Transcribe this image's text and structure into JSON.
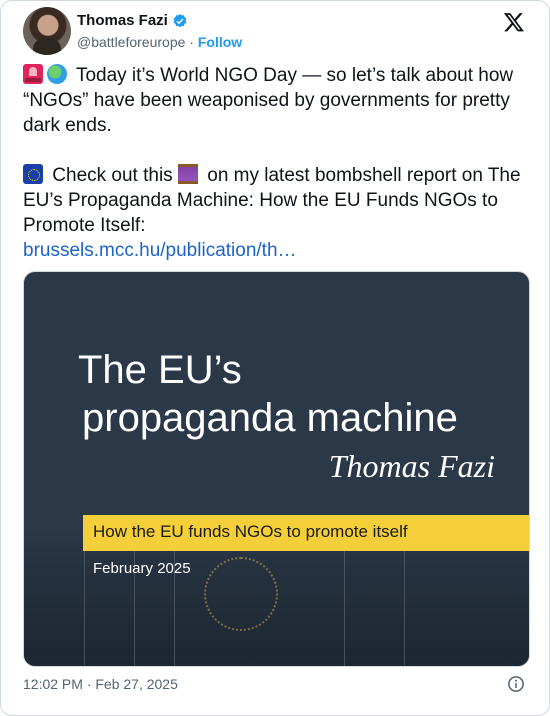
{
  "author": {
    "name": "Thomas Fazi",
    "handle": "@battleforeurope",
    "separator": "·",
    "follow_label": "Follow"
  },
  "tweet": {
    "line1_text": "Today it’s World NGO Day — so let’s talk about how “NGOs” have been weaponised by governments for pretty dark ends.",
    "line2_pre": "Check out this",
    "line2_post": "on my latest bombshell report on The EU’s Propaganda Machine: How the EU Funds NGOs to Promote Itself:",
    "link_text": "brussels.mcc.hu/publication/th…"
  },
  "media": {
    "title_line1": "The EU’s",
    "title_line2": "propaganda machine",
    "author": "Thomas Fazi",
    "subtitle": "How the EU funds NGOs to promote itself",
    "date": "February 2025"
  },
  "footer": {
    "timestamp": "12:02 PM · Feb 27, 2025"
  },
  "icons": {
    "verified": "verified-badge-icon",
    "x_logo": "x-logo-icon",
    "info": "info-icon"
  },
  "colors": {
    "accent": "#1d9bf0",
    "link": "#1d63c8",
    "banner": "#f5cf3a",
    "cover_bg": "#2b3848"
  }
}
